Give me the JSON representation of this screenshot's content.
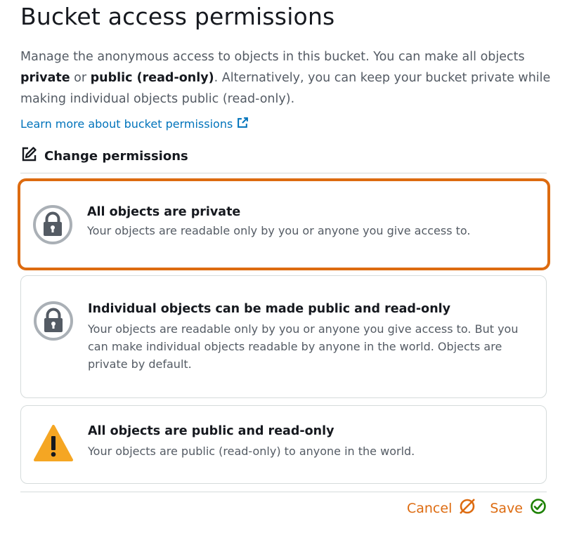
{
  "page": {
    "title": "Bucket access permissions",
    "description_1": "Manage the anonymous access to objects in this bucket. You can make all objects ",
    "desc_private": "private",
    "desc_or": " or ",
    "desc_public": "public (read-only)",
    "description_2": ". Alternatively, you can keep your bucket private while making individual objects public (read-only).",
    "learn_more": "Learn more about bucket permissions",
    "change_permissions": "Change permissions"
  },
  "options": [
    {
      "title": "All objects are private",
      "description": "Your objects are readable only by you or anyone you give access to.",
      "icon": "lock-icon",
      "selected": true
    },
    {
      "title": "Individual objects can be made public and read-only",
      "description": "Your objects are readable only by you or anyone you give access to. But you can make individual objects readable by anyone in the world. Objects are private by default.",
      "icon": "lock-icon",
      "selected": false
    },
    {
      "title": "All objects are public and read-only",
      "description": "Your objects are public (read-only) to anyone in the world.",
      "icon": "warning-icon",
      "selected": false
    }
  ],
  "footer": {
    "cancel_label": "Cancel",
    "save_label": "Save"
  },
  "colors": {
    "accent": "#dd6b10",
    "link": "#0073bb",
    "success": "#1d8102",
    "warning": "#f5a623"
  }
}
